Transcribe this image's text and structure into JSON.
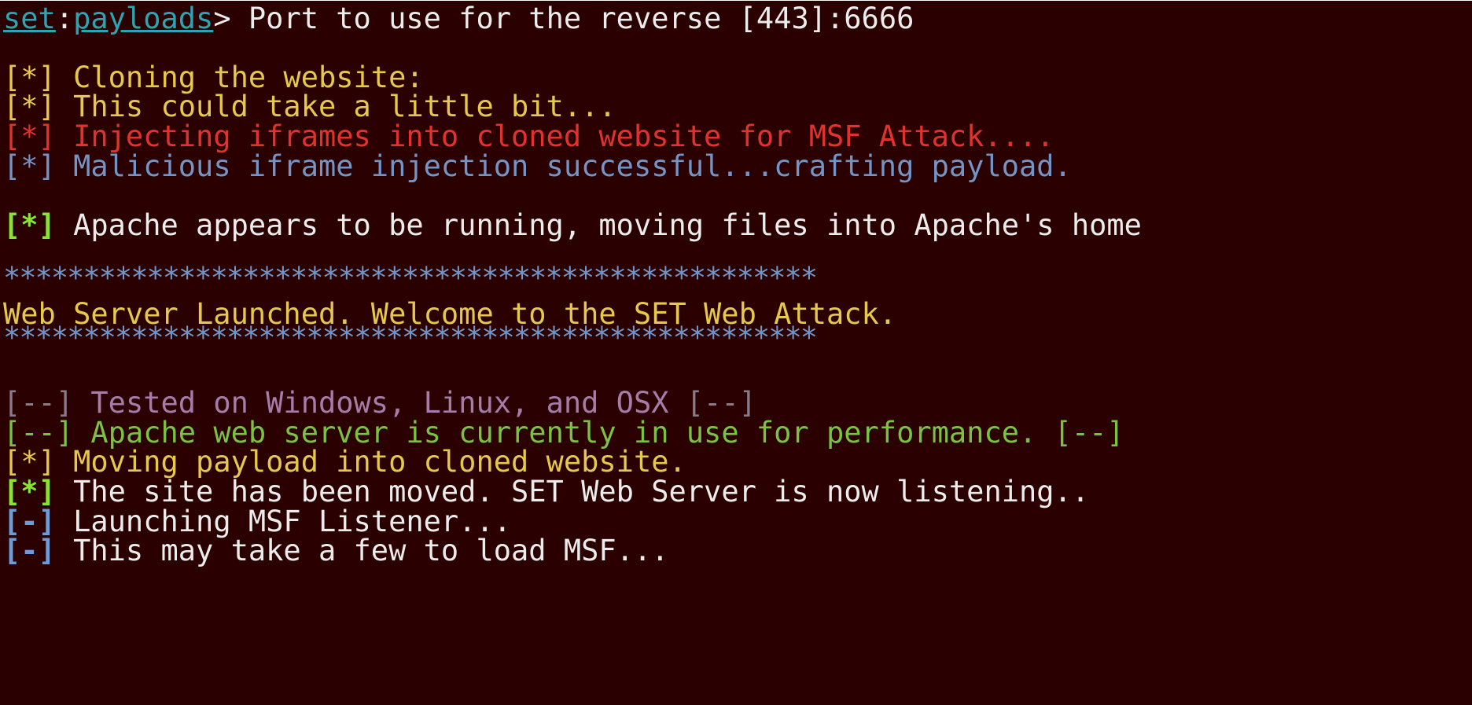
{
  "colors": {
    "background": "#2b0000",
    "default_text": "#ececec",
    "prompt_link": "#2ca5b3",
    "yellow": "#e6c84c",
    "red": "#e0322f",
    "blue": "#7494c6",
    "bright_green": "#8ae234",
    "green": "#7cc242",
    "purple": "#a77cab",
    "grey": "#8a7a8a",
    "bright_blue": "#6f9bd6"
  },
  "prompt": {
    "set": "set",
    "colon": ":",
    "payloads": "payloads",
    "arrow": "> ",
    "question": "Port to use for the reverse [443]:6666"
  },
  "lines": {
    "cloning_tag": "[*] ",
    "cloning_text": "Cloning the website:",
    "bit_tag": "[*] ",
    "bit_text": "This could take a little bit...",
    "inject_tag": "[*] ",
    "inject_text": "Injecting iframes into cloned website for MSF Attack....",
    "malicious_tag": "[*] ",
    "malicious_text": "Malicious iframe injection successful...crafting payload.",
    "apache_tag": "[*] ",
    "apache_text": "Apache appears to be running, moving files into Apache's home",
    "stars_top": "***************************************************",
    "launched": "Web Server Launched. Welcome to the SET Web Attack.",
    "stars_bottom": "***************************************************",
    "tested_tag1": "[--] ",
    "tested_text": "Tested on Windows, Linux, and OSX",
    "tested_tag2": " [--]",
    "perf_tag1": "[--] ",
    "perf_text": "Apache web server is currently in use for performance.",
    "perf_tag2": " [--]",
    "moving_tag": "[*] ",
    "moving_text": "Moving payload into cloned website.",
    "moved_tag": "[*] ",
    "moved_text": "The site has been moved. SET Web Server is now listening..",
    "listener_tag": "[-] ",
    "listener_text": "Launching MSF Listener...",
    "load_tag": "[-] ",
    "load_text": "This may take a few to load MSF..."
  }
}
